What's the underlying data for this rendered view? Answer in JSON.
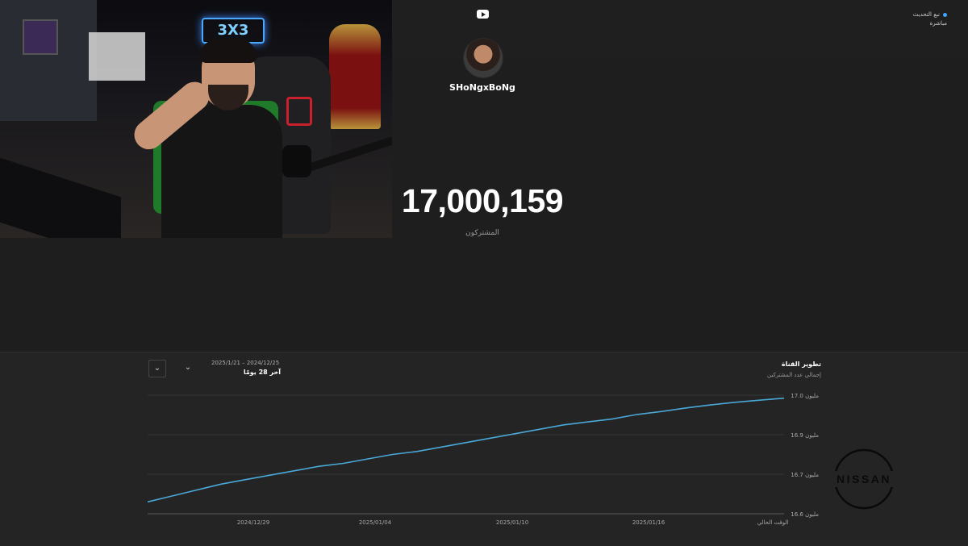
{
  "top_bar": {
    "live_label": "نبع التحديث",
    "live_sub": "مباشرة"
  },
  "channel": {
    "name": "SHoNgxBoNg",
    "subscriber_count": "17,000,159",
    "subscriber_label": "المشتركون"
  },
  "webcam": {
    "sign_text": "3X3"
  },
  "chart_panel": {
    "range_dates": "2025/1/21 – 2024/12/25",
    "range_label": "آخر 28 يومًا",
    "title": "تطوير القناة",
    "subtitle": "إجمالي عدد المشتركين"
  },
  "chart_data": {
    "type": "line",
    "title": "تطوير القناة",
    "subtitle": "إجمالي عدد المشتركين",
    "x_ticks": [
      "2024/12/29",
      "2025/01/04",
      "2025/01/10",
      "2025/01/16",
      "الوقت الحالي"
    ],
    "y_ticks": [
      "16.6 مليون",
      "16.7 مليون",
      "16.9 مليون",
      "17.0 مليون"
    ],
    "ylim": [
      16.6,
      17.0
    ],
    "y_unit": "million",
    "series": [
      {
        "values": [
          16.64,
          16.66,
          16.68,
          16.7,
          16.715,
          16.73,
          16.745,
          16.76,
          16.77,
          16.785,
          16.8,
          16.81,
          16.825,
          16.84,
          16.855,
          16.87,
          16.885,
          16.9,
          16.91,
          16.92,
          16.935,
          16.945,
          16.957,
          16.967,
          16.976,
          16.983,
          16.99
        ],
        "color": "#4aa8d8"
      }
    ],
    "grid": true
  },
  "watermark": {
    "brand": "NISSAN"
  }
}
